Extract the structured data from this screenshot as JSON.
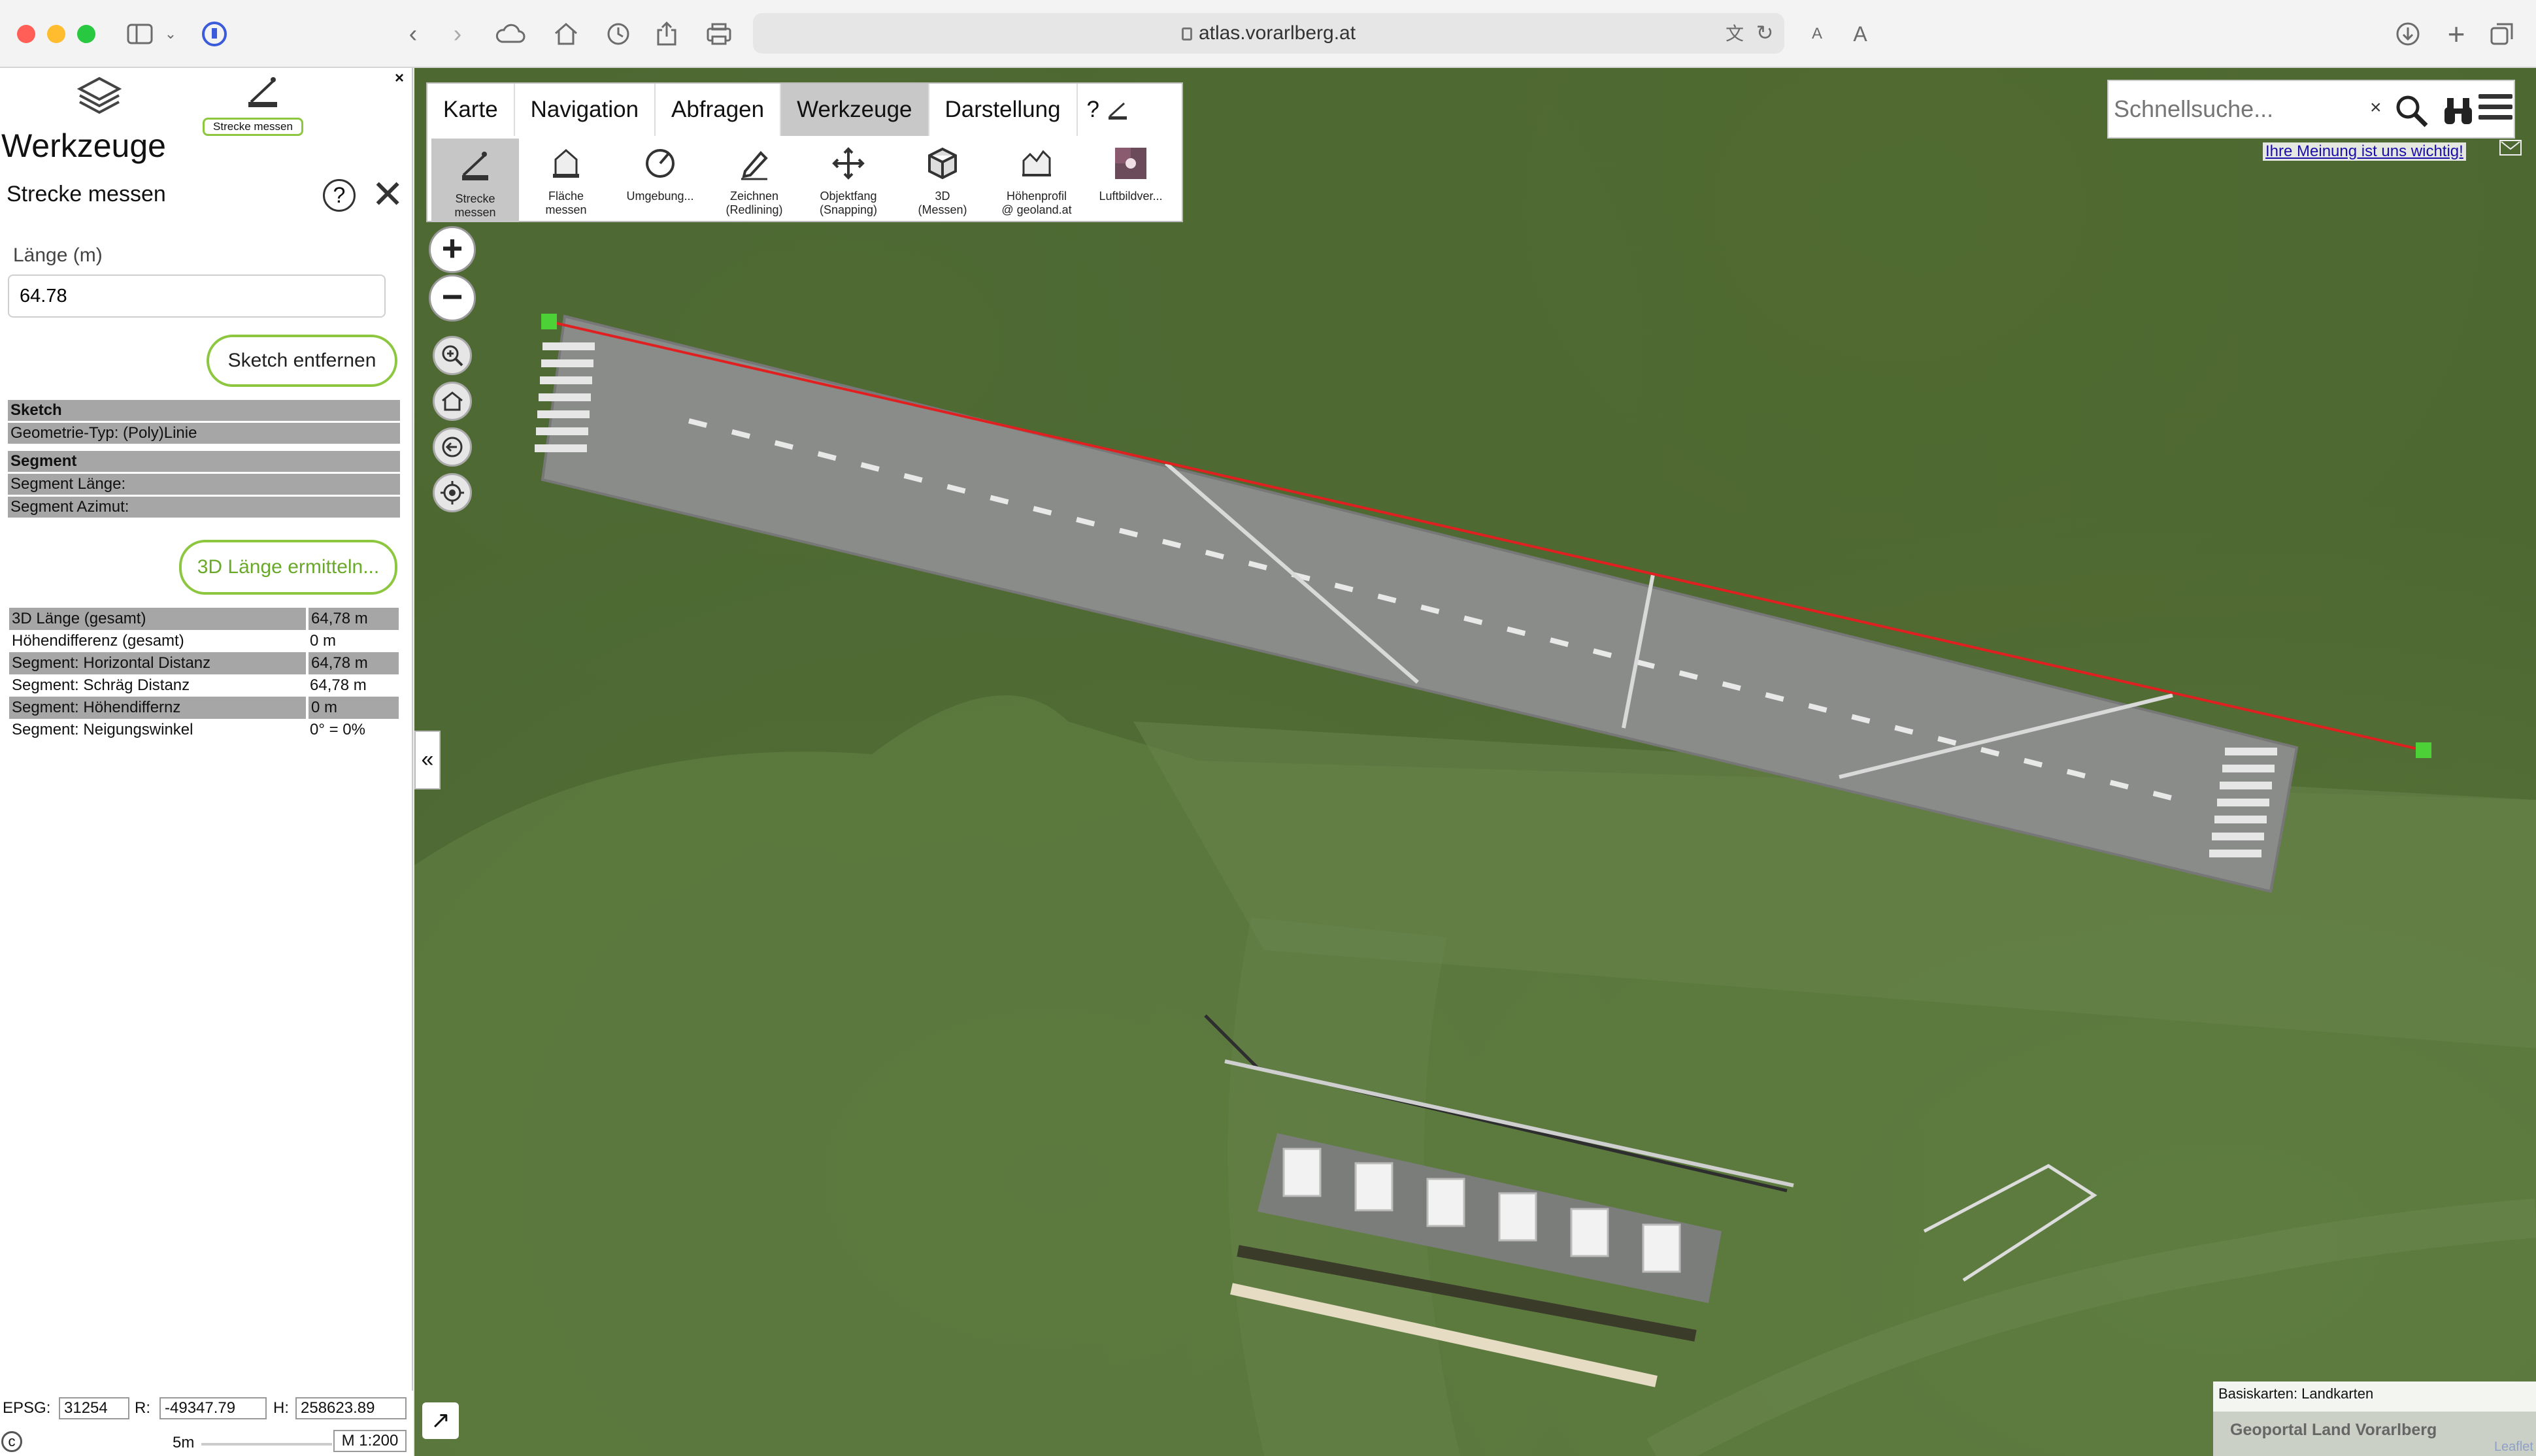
{
  "browser": {
    "url": "atlas.vorarlberg.at"
  },
  "panel": {
    "tool_chip_label": "Strecke messen",
    "title": "Werkzeuge",
    "tool_title": "Strecke messen",
    "length_label": "Länge (m)",
    "length_value": "64.78",
    "sketch_remove_label": "Sketch entfernen",
    "sketch_header": "Sketch",
    "geometry_type": "Geometrie-Typ:  (Poly)Linie",
    "segment_header": "Segment",
    "segment_length": "Segment Länge:",
    "segment_azimuth": "Segment Azimut:",
    "length3d_button": "3D Länge ermitteln...",
    "results": [
      {
        "label": "3D Länge (gesamt)",
        "value": "64,78 m"
      },
      {
        "label": "Höhendifferenz (gesamt)",
        "value": "0 m"
      },
      {
        "label": "Segment: Horizontal Distanz",
        "value": "64,78 m"
      },
      {
        "label": "Segment: Schräg Distanz",
        "value": "64,78 m"
      },
      {
        "label": "Segment: Höhendiffernz",
        "value": "0 m"
      },
      {
        "label": "Segment: Neigungswinkel",
        "value": "0° = 0%"
      }
    ]
  },
  "coords": {
    "epsg_label": "EPSG:",
    "epsg_value": "31254",
    "r_label": "R:",
    "r_value": "-49347.79",
    "h_label": "H:",
    "h_value": "258623.89",
    "scale_bar": "5m",
    "scale_ratio": "M 1:200"
  },
  "map_menu": {
    "tabs": [
      "Karte",
      "Navigation",
      "Abfragen",
      "Werkzeuge",
      "Darstellung",
      "?"
    ],
    "active_tab": "Werkzeuge",
    "tools": [
      {
        "line1": "Strecke",
        "line2": "messen",
        "icon": "ruler-icon"
      },
      {
        "line1": "Fläche",
        "line2": "messen",
        "icon": "area-icon"
      },
      {
        "line1": "Umgebung...",
        "line2": "",
        "icon": "radius-icon"
      },
      {
        "line1": "Zeichnen",
        "line2": "(Redlining)",
        "icon": "pen-icon"
      },
      {
        "line1": "Objektfang",
        "line2": "(Snapping)",
        "icon": "snap-icon"
      },
      {
        "line1": "3D",
        "line2": "(Messen)",
        "icon": "cube-icon"
      },
      {
        "line1": "Höhenprofil",
        "line2": "@ geoland.at",
        "icon": "profile-icon"
      },
      {
        "line1": "Luftbildver...",
        "line2": "",
        "icon": "aerial-icon"
      }
    ]
  },
  "search": {
    "placeholder": "Schnellsuche...",
    "clear": "×"
  },
  "feedback_link": "Ihre Meinung ist uns wichtig!",
  "attribution": {
    "basemap": "Basiskarten: Landkarten",
    "geoportal": "Geoportal Land Vorarlberg",
    "leaflet": "Leaflet"
  },
  "colors": {
    "measure_line": "#e02020",
    "vertex": "#4cd137",
    "accent_green": "#8dc63f"
  }
}
